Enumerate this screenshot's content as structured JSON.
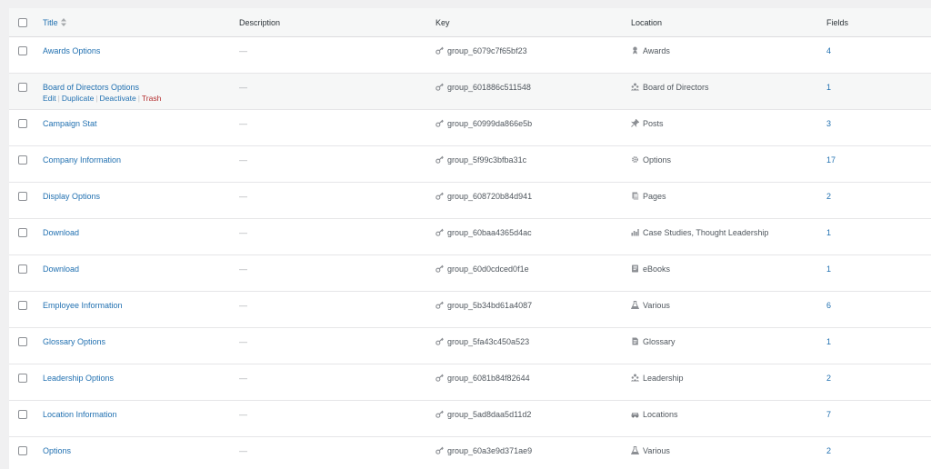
{
  "header": {
    "title": "Title",
    "description": "Description",
    "key": "Key",
    "location": "Location",
    "fields": "Fields"
  },
  "row_actions": {
    "edit": "Edit",
    "duplicate": "Duplicate",
    "deactivate": "Deactivate",
    "trash": "Trash",
    "separator": "|"
  },
  "colors": {
    "link": "#2271b1",
    "trash": "#b32d2e",
    "hover_row": "#f6f7f7"
  },
  "rows": [
    {
      "title": "Awards Options",
      "description": "—",
      "key": "group_6079c7f65bf23",
      "location": "Awards",
      "location_icon": "award-icon",
      "fields": "4"
    },
    {
      "title": "Board of Directors Options",
      "description": "—",
      "key": "group_601886c511548",
      "location": "Board of Directors",
      "location_icon": "groups-icon",
      "fields": "1"
    },
    {
      "title": "Campaign Stat",
      "description": "—",
      "key": "group_60999da866e5b",
      "location": "Posts",
      "location_icon": "pin-icon",
      "fields": "3"
    },
    {
      "title": "Company Information",
      "description": "—",
      "key": "group_5f99c3bfba31c",
      "location": "Options",
      "location_icon": "gear-icon",
      "fields": "17"
    },
    {
      "title": "Display Options",
      "description": "—",
      "key": "group_608720b84d941",
      "location": "Pages",
      "location_icon": "pages-icon",
      "fields": "2"
    },
    {
      "title": "Download",
      "description": "—",
      "key": "group_60baa4365d4ac",
      "location": "Case Studies, Thought Leadership",
      "location_icon": "chart-icon",
      "fields": "1"
    },
    {
      "title": "Download",
      "description": "—",
      "key": "group_60d0cdced0f1e",
      "location": "eBooks",
      "location_icon": "book-icon",
      "fields": "1"
    },
    {
      "title": "Employee Information",
      "description": "—",
      "key": "group_5b34bd61a4087",
      "location": " Various",
      "location_icon": "flask-icon",
      "fields": "6"
    },
    {
      "title": "Glossary Options",
      "description": "—",
      "key": "group_5fa43c450a523",
      "location": "Glossary",
      "location_icon": "document-icon",
      "fields": "1"
    },
    {
      "title": "Leadership Options",
      "description": "—",
      "key": "group_6081b84f82644",
      "location": "Leadership",
      "location_icon": "groups-icon",
      "fields": "2"
    },
    {
      "title": "Location Information",
      "description": "—",
      "key": "group_5ad8daa5d11d2",
      "location": "Locations",
      "location_icon": "car-icon",
      "fields": "7"
    },
    {
      "title": "Options",
      "description": "—",
      "key": "group_60a3e9d371ae9",
      "location": " Various",
      "location_icon": "flask-icon",
      "fields": "2"
    }
  ]
}
